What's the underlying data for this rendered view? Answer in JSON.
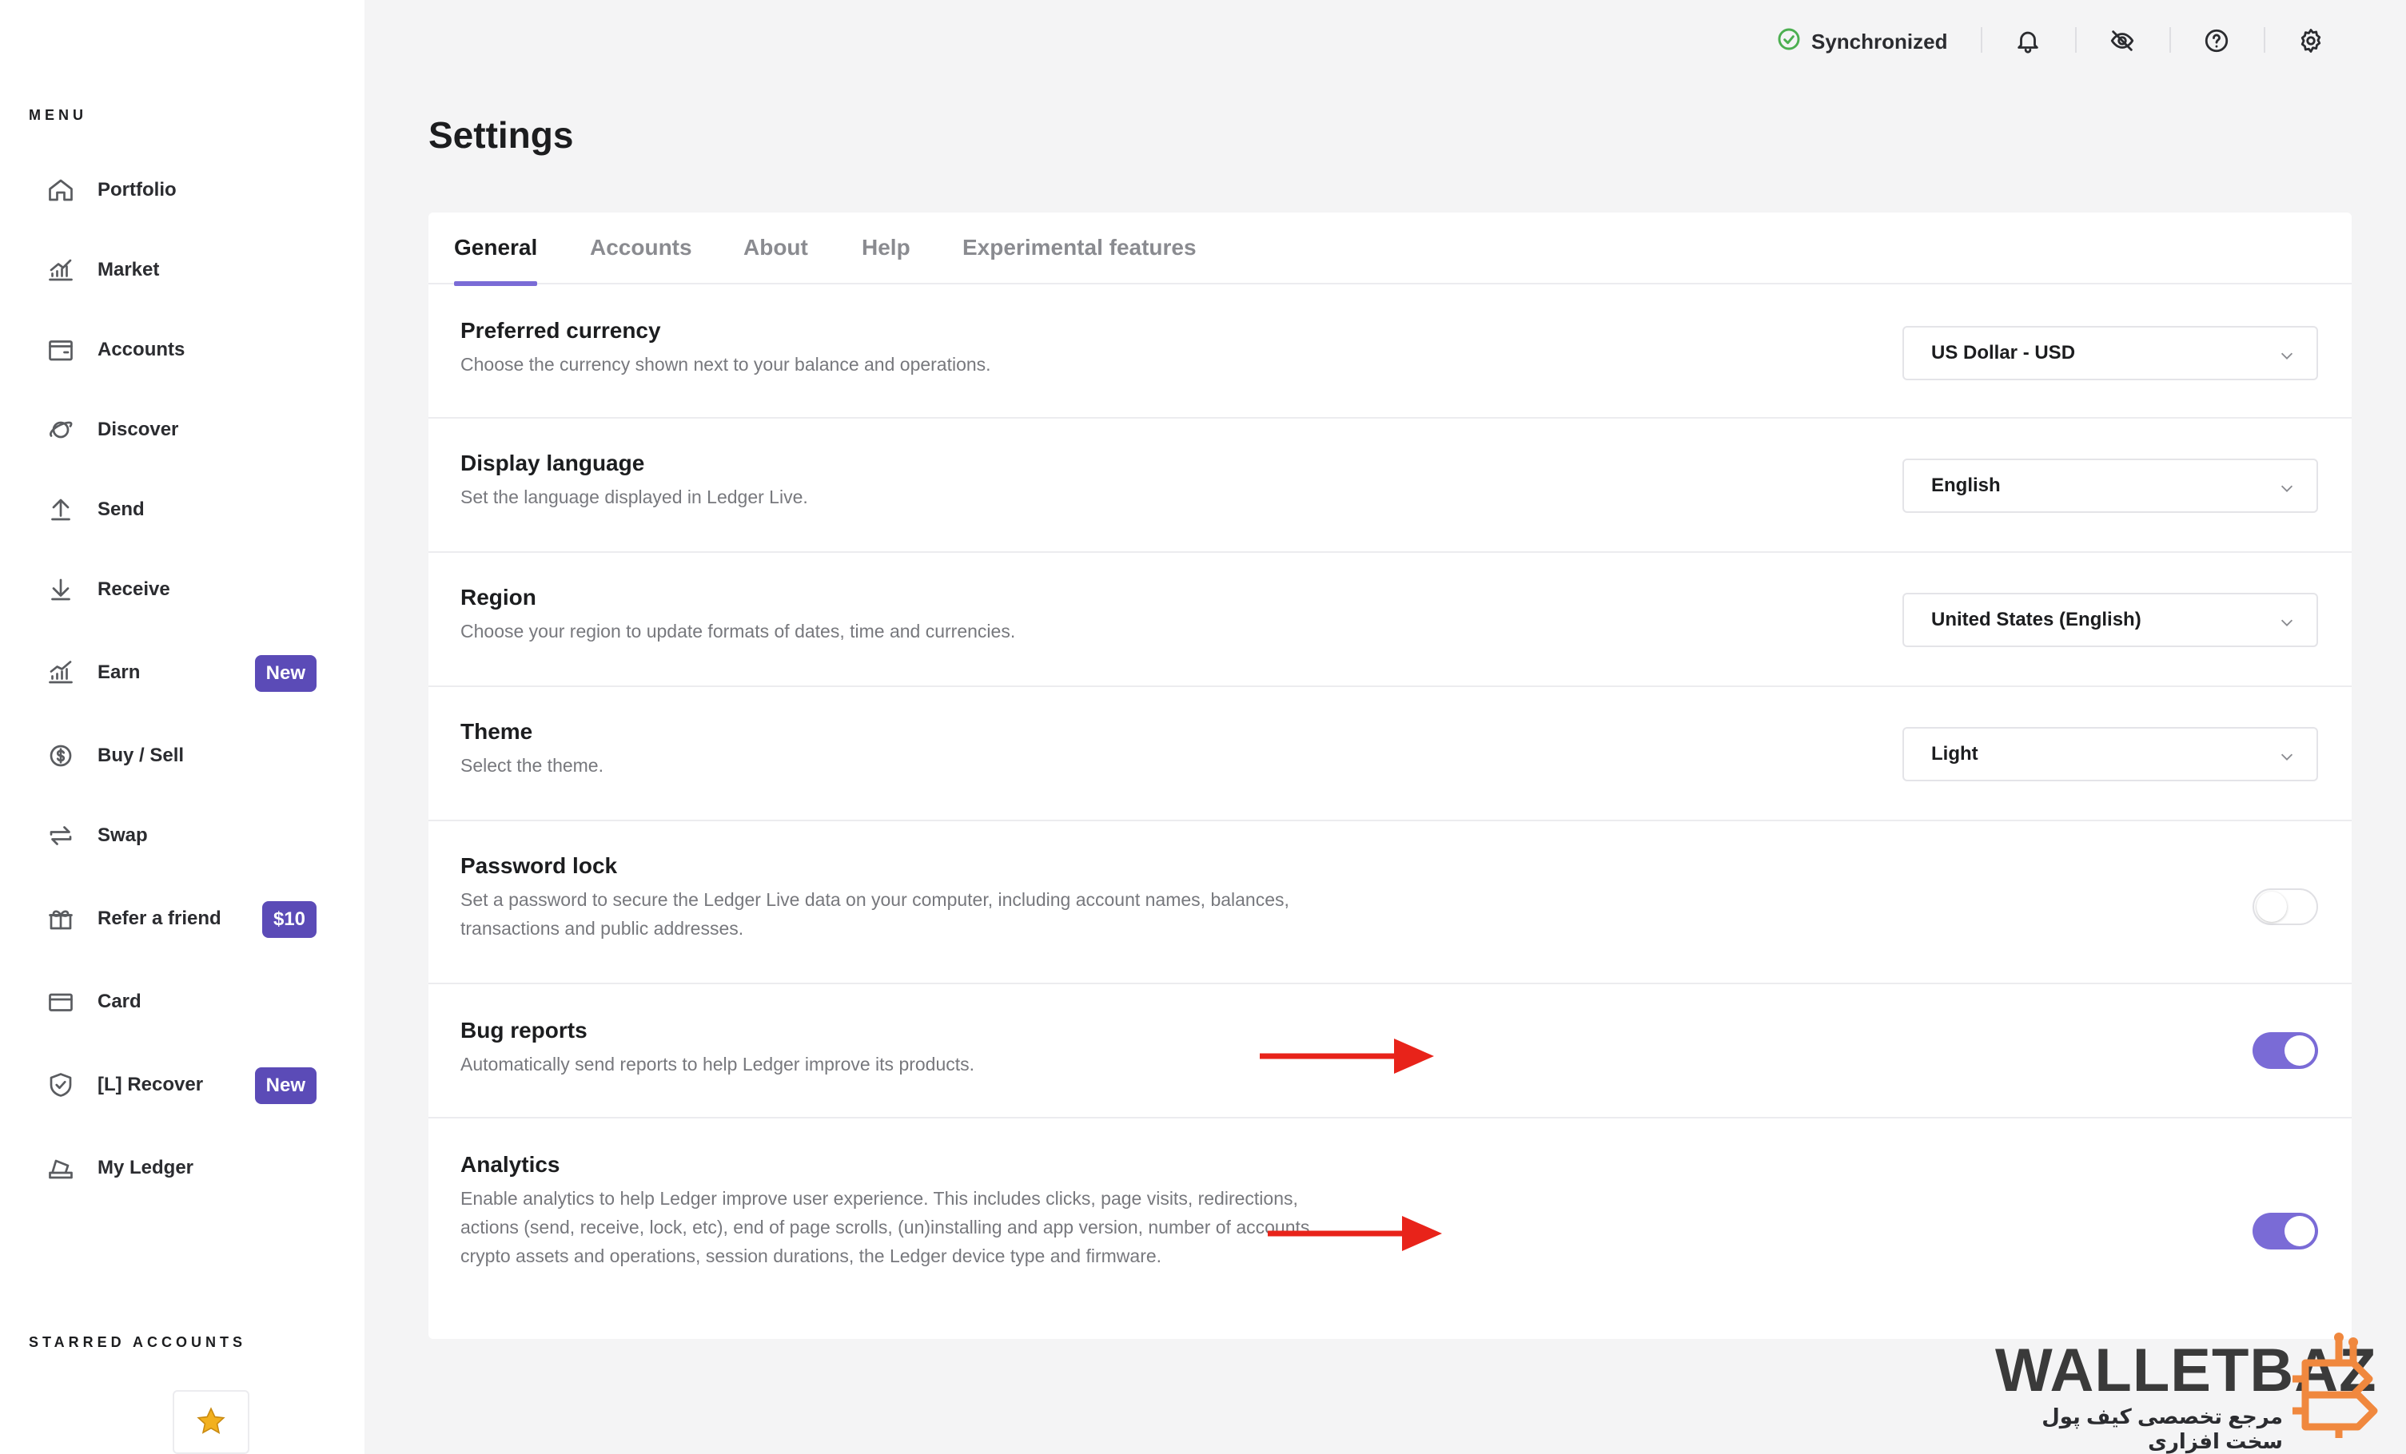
{
  "sidebar": {
    "menu_title": "MENU",
    "items": [
      {
        "label": "Portfolio",
        "icon": "home-icon"
      },
      {
        "label": "Market",
        "icon": "market-chart-icon"
      },
      {
        "label": "Accounts",
        "icon": "wallet-icon"
      },
      {
        "label": "Discover",
        "icon": "planet-icon"
      },
      {
        "label": "Send",
        "icon": "arrow-up-icon"
      },
      {
        "label": "Receive",
        "icon": "arrow-down-icon"
      },
      {
        "label": "Earn",
        "icon": "growth-chart-icon",
        "badge": "New"
      },
      {
        "label": "Buy / Sell",
        "icon": "dollar-coin-icon"
      },
      {
        "label": "Swap",
        "icon": "swap-arrows-icon"
      },
      {
        "label": "Refer a friend",
        "icon": "gift-icon",
        "badge": "$10"
      },
      {
        "label": "Card",
        "icon": "card-icon"
      },
      {
        "label": "[L] Recover",
        "icon": "shield-check-icon",
        "badge": "New"
      },
      {
        "label": "My Ledger",
        "icon": "ledger-device-icon"
      }
    ],
    "starred_title": "STARRED ACCOUNTS"
  },
  "topbar": {
    "sync_label": "Synchronized",
    "icons": [
      "bell-icon",
      "eye-off-icon",
      "help-icon",
      "settings-gear-icon"
    ]
  },
  "page": {
    "title": "Settings"
  },
  "tabs": [
    "General",
    "Accounts",
    "About",
    "Help",
    "Experimental features"
  ],
  "active_tab": "General",
  "settings": {
    "currency": {
      "title": "Preferred currency",
      "desc": "Choose the currency shown next to your balance and operations.",
      "value": "US Dollar - USD"
    },
    "language": {
      "title": "Display language",
      "desc": "Set the language displayed in Ledger Live.",
      "value": "English"
    },
    "region": {
      "title": "Region",
      "desc": "Choose your region to update formats of dates, time and currencies.",
      "value": "United States (English)"
    },
    "theme": {
      "title": "Theme",
      "desc": "Select the theme.",
      "value": "Light"
    },
    "password": {
      "title": "Password lock",
      "desc": "Set a password to secure the Ledger Live data on your computer, including account names, balances, transactions and public addresses.",
      "enabled": false
    },
    "bug_reports": {
      "title": "Bug reports",
      "desc": "Automatically send reports to help Ledger improve its products.",
      "enabled": true
    },
    "analytics": {
      "title": "Analytics",
      "desc": "Enable analytics to help Ledger improve user experience. This includes clicks, page visits, redirections, actions (send, receive, lock, etc), end of page scrolls, (un)installing and app version, number of accounts, crypto assets and operations, session durations, the Ledger device type and firmware.",
      "enabled": true
    }
  },
  "colors": {
    "accent": "#7a6bd6",
    "badge": "#5b4bb7",
    "sync_green": "#4caf50",
    "annotation_arrow": "#e8231a"
  },
  "watermark": {
    "brand": "WALLETBAZ",
    "tagline": "مرجع تخصصی کیف پول سخت افزاری"
  }
}
